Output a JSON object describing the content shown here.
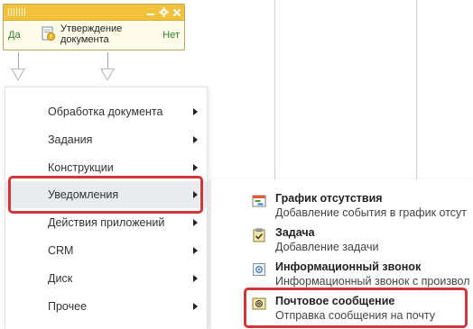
{
  "activity": {
    "title": "Утверждение документа",
    "yes_label": "Да",
    "no_label": "Нет",
    "header_color": "#f2c23c",
    "icons": [
      "grip-icon",
      "minimize-icon",
      "settings-gear-icon",
      "close-icon",
      "document-approval-icon"
    ]
  },
  "menu": {
    "items": [
      {
        "label": "Обработка документа"
      },
      {
        "label": "Задания"
      },
      {
        "label": "Конструкции"
      },
      {
        "label": "Уведомления",
        "active": true
      },
      {
        "label": "Действия приложений"
      },
      {
        "label": "CRM"
      },
      {
        "label": "Диск"
      },
      {
        "label": "Прочее"
      }
    ]
  },
  "submenu": {
    "items": [
      {
        "title": "График отсутствия",
        "description": "Добавление события в график отсут",
        "icon": "calendar-icon"
      },
      {
        "title": "Задача",
        "description": "Добавление задачи",
        "icon": "task-clipboard-icon"
      },
      {
        "title": "Информационный звонок",
        "description": "Информационный звонок с произвол",
        "icon": "info-call-icon"
      },
      {
        "title": "Почтовое сообщение",
        "description": "Отправка сообщения на почту",
        "icon": "mail-icon"
      }
    ]
  },
  "highlight_color": "#d0373a"
}
